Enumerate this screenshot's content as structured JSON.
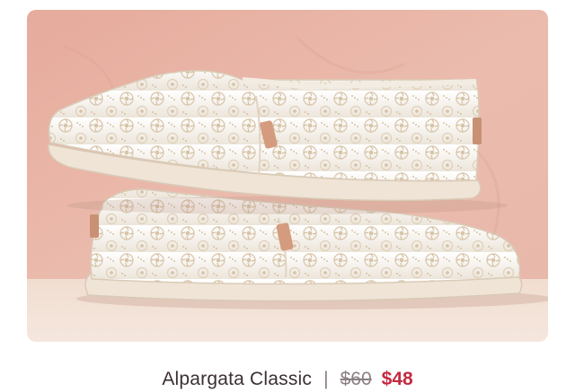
{
  "product": {
    "image_alt": "Alpargata Classic slip-on shoes",
    "name": "Alpargata Classic",
    "divider": "|",
    "original_price": "$60",
    "sale_price": "$48"
  },
  "colors": {
    "background_wall": "#e9b7a8",
    "floor": "#f3e2d7",
    "shoe": "#f5f1ea",
    "lace_pattern": "#d9c7ae",
    "sale_price": "#c42a41",
    "strikethrough_price": "#8a7f83",
    "product_name": "#3b2f34"
  }
}
